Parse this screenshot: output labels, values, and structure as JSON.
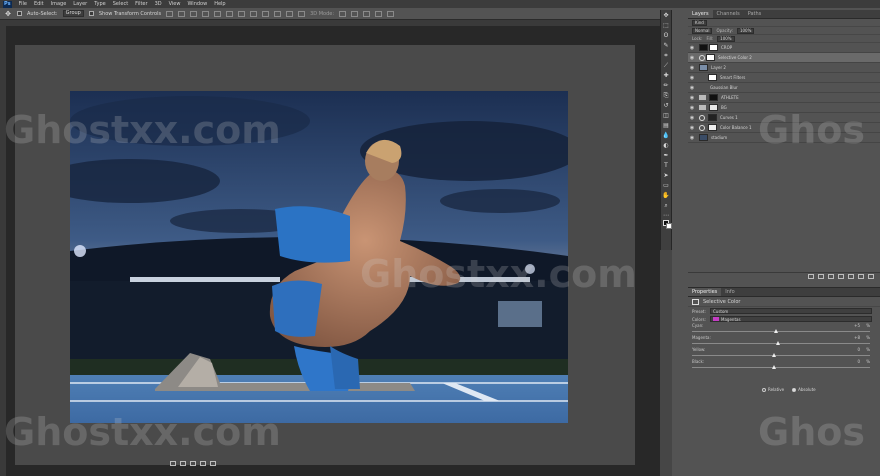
{
  "menubar": {
    "logo": "Ps",
    "items": [
      "File",
      "Edit",
      "Image",
      "Layer",
      "Type",
      "Select",
      "Filter",
      "3D",
      "View",
      "Window",
      "Help"
    ]
  },
  "optionsbar": {
    "auto_select_label": "Auto-Select:",
    "auto_select_value": "Group",
    "transform_controls": "Show Transform Controls",
    "mode_3d": "3D Mode:"
  },
  "tools": {
    "icons": [
      "move-icon",
      "marquee-icon",
      "lasso-icon",
      "quick-select-icon",
      "crop-icon",
      "eyedropper-icon",
      "healing-icon",
      "brush-icon",
      "stamp-icon",
      "history-brush-icon",
      "eraser-icon",
      "gradient-icon",
      "blur-icon",
      "dodge-icon",
      "pen-icon",
      "type-icon",
      "path-select-icon",
      "shape-icon",
      "hand-icon",
      "zoom-icon",
      "more-icon"
    ],
    "glyphs": [
      "✥",
      "⬚",
      "ʘ",
      "✎",
      "⌗",
      "⟋",
      "✚",
      "✏",
      "⎘",
      "↺",
      "◫",
      "▤",
      "💧",
      "◐",
      "✒",
      "T",
      "➤",
      "▭",
      "✋",
      "⌕",
      "⋯"
    ]
  },
  "layers_panel": {
    "tabs": [
      "Layers",
      "Channels",
      "Paths"
    ],
    "filter_kind": "Kind",
    "blend_mode": "Normal",
    "opacity_label": "Opacity:",
    "opacity_value": "100%",
    "lock_label": "Lock:",
    "fill_label": "Fill:",
    "fill_value": "100%",
    "layers": [
      {
        "name": "CROP",
        "kind": "mask"
      },
      {
        "name": "Selective Color 2",
        "kind": "adjustment",
        "selected": true
      },
      {
        "name": "Layer 2",
        "kind": "smart"
      },
      {
        "name": "Smart Filters",
        "kind": "filter"
      },
      {
        "name": "Gaussian Blur",
        "kind": "filter"
      },
      {
        "name": "ATHLETE",
        "kind": "folder"
      },
      {
        "name": "BG",
        "kind": "folder"
      },
      {
        "name": "Curves 1",
        "kind": "adjustment"
      },
      {
        "name": "Color Balance 1",
        "kind": "adjustment"
      },
      {
        "name": "stadium",
        "kind": "image"
      }
    ]
  },
  "properties_panel": {
    "tabs": [
      "Properties",
      "Info"
    ],
    "title": "Selective Color",
    "preset_label": "Preset:",
    "preset_value": "Custom",
    "colors_label": "Colors:",
    "colors_value": "Magentas",
    "colors_swatch": "#c43ec4",
    "sliders": [
      {
        "name": "Cyan:",
        "value": "+5"
      },
      {
        "name": "Magenta:",
        "value": "+8"
      },
      {
        "name": "Yellow:",
        "value": "0"
      },
      {
        "name": "Black:",
        "value": "0"
      }
    ],
    "percent": "%",
    "method_relative": "Relative",
    "method_absolute": "Absolute",
    "method_selected": "Absolute"
  },
  "watermark": {
    "text": "Ghostxx.com",
    "text_partial": "Ghos"
  }
}
